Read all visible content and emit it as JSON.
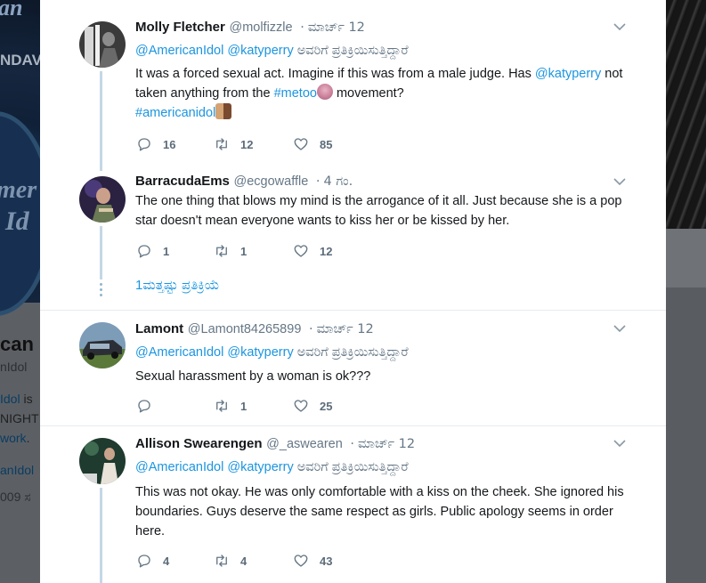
{
  "background": {
    "hero_fragment_top": "an",
    "hero_fragment_sunday": "NDAV",
    "hero_logo_1": "mer",
    "hero_logo_2": "Id",
    "title_fragment": "can I",
    "handle_fragment": "nIdol",
    "line1_link": "Idol",
    "line1_text": " is",
    "line2": "NIGHT",
    "line3_link": "work",
    "line3_punct": ".",
    "line4_link": "anIdol",
    "line5": "009 ಸ"
  },
  "tweets": [
    {
      "name": "Molly Fletcher",
      "handle": "@molfizzle",
      "dot": "·",
      "time": "ಮಾರ್ಚ್ 12",
      "reply_mentions": "@AmericanIdol @katyperry",
      "reply_suffix": " ಅವರಿಗೆ ಪ್ರತಿಕ್ರಿಯಿಸುತ್ತಿದ್ದಾರೆ",
      "text_1": "It was a forced sexual act. Imagine if this was from a male judge. Has ",
      "text_link_1": "@katyperry",
      "text_2": " not taken anything from the ",
      "text_link_2": "#metoo",
      "text_3": " movement?",
      "text_link_3": "#americanidol",
      "replies": "16",
      "retweets": "12",
      "likes": "85"
    },
    {
      "name": "BarracudaEms",
      "handle": "@ecgowaffle",
      "dot": "·",
      "time": "4 ಗಂ.",
      "text": "The one thing that blows my mind is the arrogance of it all. Just because she is a pop star doesn't mean everyone wants to kiss her or be kissed by her.",
      "replies": "1",
      "retweets": "1",
      "likes": "12",
      "more_replies": "1ಮತ್ತಷ್ಟು ಪ್ರತಿಕ್ರಿಯೆ"
    },
    {
      "name": "Lamont",
      "handle": "@Lamont84265899",
      "dot": "·",
      "time": "ಮಾರ್ಚ್ 12",
      "reply_mentions": "@AmericanIdol @katyperry",
      "reply_suffix": " ಅವರಿಗೆ ಪ್ರತಿಕ್ರಿಯಿಸುತ್ತಿದ್ದಾರೆ",
      "text": "Sexual harassment by a woman is ok???",
      "replies": "",
      "retweets": "1",
      "likes": "25"
    },
    {
      "name": "Allison Swearengen",
      "handle": "@_aswearen",
      "dot": "·",
      "time": "ಮಾರ್ಚ್ 12",
      "reply_mentions": "@AmericanIdol @katyperry",
      "reply_suffix": " ಅವರಿಗೆ ಪ್ರತಿಕ್ರಿಯಿಸುತ್ತಿದ್ದಾರೆ",
      "text": "This was not okay. He was only comfortable with a kiss on the cheek. She ignored his boundaries. Guys deserve the same respect as girls. Public apology seems in order here.",
      "replies": "4",
      "retweets": "4",
      "likes": "43"
    }
  ],
  "icons": {
    "reply": "reply-icon",
    "retweet": "retweet-icon",
    "like": "heart-icon",
    "menu": "chevron-down-icon"
  },
  "colors": {
    "link": "#1b95e0",
    "text": "#14171a",
    "muted": "#657786",
    "thread": "#c4d8e6"
  }
}
